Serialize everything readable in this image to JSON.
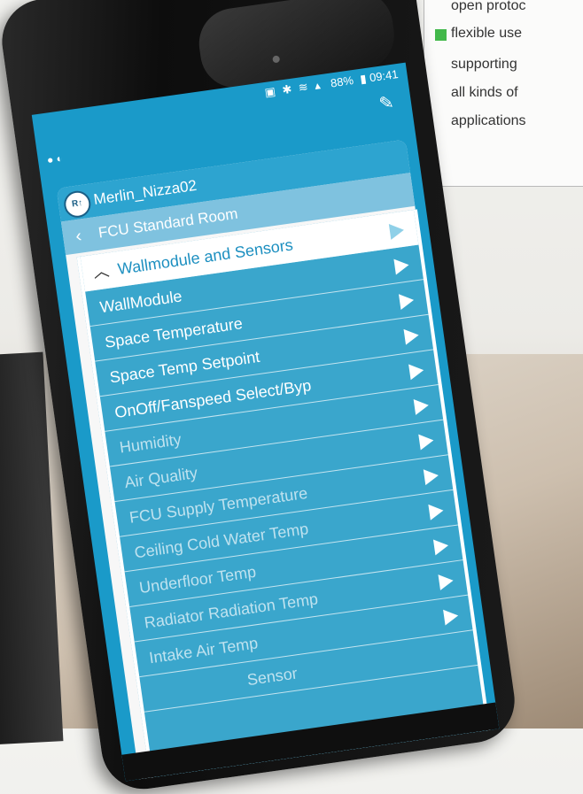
{
  "brochure": {
    "lines": [
      "open protoc",
      "flexible use",
      "supporting",
      "all kinds of",
      "applications"
    ]
  },
  "status_bar": {
    "icons": "▣ ✱ ≋ ▴",
    "battery": "88%",
    "time": "09:41"
  },
  "app": {
    "site_name": "Merlin_Nizza02",
    "room_name": "FCU Standard Room",
    "section_title": "Wallmodule and Sensors",
    "logo_text": "R↑"
  },
  "list_items": [
    {
      "label": "WallModule",
      "enabled": true
    },
    {
      "label": "Space Temperature",
      "enabled": true
    },
    {
      "label": "Space Temp Setpoint",
      "enabled": true
    },
    {
      "label": "OnOff/Fanspeed Select/Byp",
      "enabled": true
    },
    {
      "label": "Humidity",
      "enabled": false
    },
    {
      "label": "Air Quality",
      "enabled": false
    },
    {
      "label": "FCU Supply Temperature",
      "enabled": false
    },
    {
      "label": "Ceiling Cold Water Temp",
      "enabled": false
    },
    {
      "label": "Underfloor Temp",
      "enabled": false
    },
    {
      "label": "Radiator Radiation Temp",
      "enabled": false
    },
    {
      "label": "Intake Air Temp",
      "enabled": false
    },
    {
      "label": "Sensor",
      "enabled": false
    }
  ],
  "colors": {
    "screen_bg": "#1a9ac9",
    "list_bg": "#3aa6cc",
    "bullet": "#42b84a"
  }
}
